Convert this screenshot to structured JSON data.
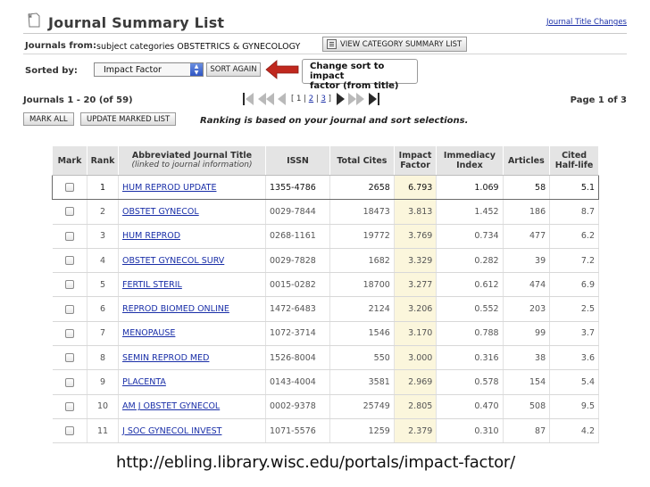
{
  "header": {
    "title": "Journal Summary List",
    "title_changes_link": "Journal Title Changes",
    "icon": "document-icon"
  },
  "journals_from": {
    "label": "Journals from:",
    "value": "subject categories OBSTETRICS & GYNECOLOGY",
    "view_button": "VIEW CATEGORY SUMMARY LIST"
  },
  "sort": {
    "label": "Sorted by:",
    "selected": "Impact Factor",
    "sort_again_button": "SORT AGAIN",
    "callout_line1": "Change sort to impact",
    "callout_line2": "factor (from title)",
    "arrow_color": "#c0281e"
  },
  "pagination": {
    "count_label": "Journals 1 - 20 (of 59)",
    "bracket_open": "[",
    "page_current": "1",
    "sep1": "|",
    "page_2": "2",
    "sep2": "|",
    "page_3": "3",
    "bracket_close": "]",
    "page_of": "Page 1 of 3"
  },
  "actions": {
    "mark_all": "MARK ALL",
    "update_marked": "UPDATE MARKED LIST",
    "ranking_note": "Ranking is based on your journal and sort selections."
  },
  "table": {
    "headers": {
      "mark": "Mark",
      "rank": "Rank",
      "title_main": "Abbreviated Journal Title",
      "title_sub": "(linked to journal information)",
      "issn": "ISSN",
      "total_cites": "Total Cites",
      "impact_1": "Impact",
      "impact_2": "Factor",
      "immediacy_1": "Immediacy",
      "immediacy_2": "Index",
      "articles": "Articles",
      "cited_1": "Cited",
      "cited_2": "Half-life"
    },
    "rows": [
      {
        "rank": "1",
        "title": "HUM REPROD UPDATE",
        "issn": "1355-4786",
        "total_cites": "2658",
        "impact_factor": "6.793",
        "immediacy": "1.069",
        "articles": "58",
        "half_life": "5.1"
      },
      {
        "rank": "2",
        "title": "OBSTET GYNECOL",
        "issn": "0029-7844",
        "total_cites": "18473",
        "impact_factor": "3.813",
        "immediacy": "1.452",
        "articles": "186",
        "half_life": "8.7"
      },
      {
        "rank": "3",
        "title": "HUM REPROD",
        "issn": "0268-1161",
        "total_cites": "19772",
        "impact_factor": "3.769",
        "immediacy": "0.734",
        "articles": "477",
        "half_life": "6.2"
      },
      {
        "rank": "4",
        "title": "OBSTET GYNECOL SURV",
        "issn": "0029-7828",
        "total_cites": "1682",
        "impact_factor": "3.329",
        "immediacy": "0.282",
        "articles": "39",
        "half_life": "7.2"
      },
      {
        "rank": "5",
        "title": "FERTIL STERIL",
        "issn": "0015-0282",
        "total_cites": "18700",
        "impact_factor": "3.277",
        "immediacy": "0.612",
        "articles": "474",
        "half_life": "6.9"
      },
      {
        "rank": "6",
        "title": "REPROD BIOMED ONLINE",
        "issn": "1472-6483",
        "total_cites": "2124",
        "impact_factor": "3.206",
        "immediacy": "0.552",
        "articles": "203",
        "half_life": "2.5"
      },
      {
        "rank": "7",
        "title": "MENOPAUSE",
        "issn": "1072-3714",
        "total_cites": "1546",
        "impact_factor": "3.170",
        "immediacy": "0.788",
        "articles": "99",
        "half_life": "3.7"
      },
      {
        "rank": "8",
        "title": "SEMIN REPROD MED",
        "issn": "1526-8004",
        "total_cites": "550",
        "impact_factor": "3.000",
        "immediacy": "0.316",
        "articles": "38",
        "half_life": "3.6"
      },
      {
        "rank": "9",
        "title": "PLACENTA",
        "issn": "0143-4004",
        "total_cites": "3581",
        "impact_factor": "2.969",
        "immediacy": "0.578",
        "articles": "154",
        "half_life": "5.4"
      },
      {
        "rank": "10",
        "title": "AM J OBSTET GYNECOL",
        "issn": "0002-9378",
        "total_cites": "25749",
        "impact_factor": "2.805",
        "immediacy": "0.470",
        "articles": "508",
        "half_life": "9.5"
      },
      {
        "rank": "11",
        "title": "J SOC GYNECOL INVEST",
        "issn": "1071-5576",
        "total_cites": "1259",
        "impact_factor": "2.379",
        "immediacy": "0.310",
        "articles": "87",
        "half_life": "4.2"
      }
    ]
  },
  "footer": {
    "url": "http://ebling.library.wisc.edu/portals/impact-factor/"
  }
}
